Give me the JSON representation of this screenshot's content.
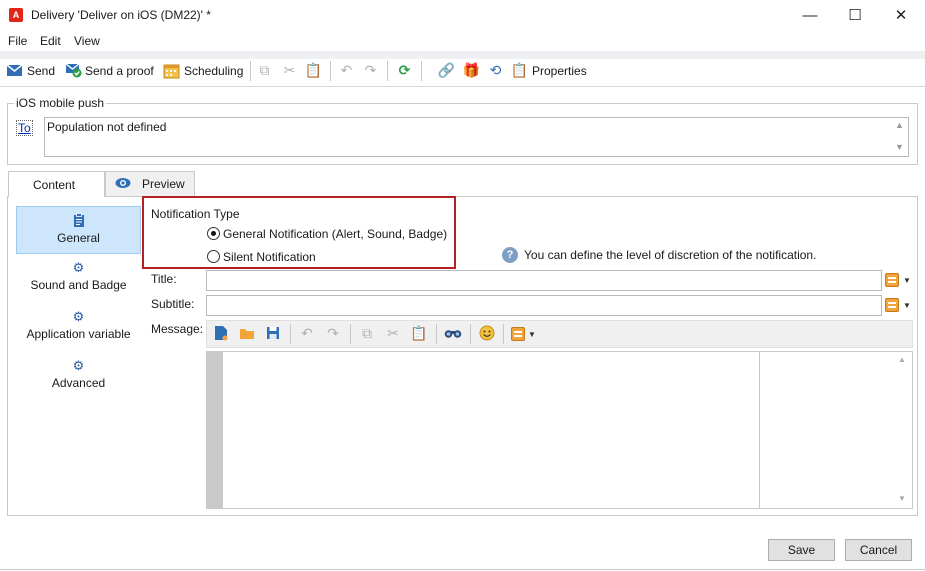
{
  "window": {
    "app_icon": "A",
    "title": "Delivery 'Deliver on iOS (DM22)' *",
    "controls": {
      "minimize": "—",
      "maximize": "☐",
      "close": "✕"
    }
  },
  "menu": [
    "File",
    "Edit",
    "View"
  ],
  "toolbar": {
    "send": "Send",
    "send_proof": "Send a proof",
    "scheduling": "Scheduling",
    "properties": "Properties",
    "icons": [
      "send-icon",
      "send-proof-icon",
      "calendar-icon",
      "copy-icon",
      "cut-icon",
      "paste-icon",
      "undo-icon",
      "redo-icon",
      "refresh-icon",
      "link-icon",
      "gift-icon",
      "gauge-icon",
      "clipboard-icon"
    ]
  },
  "push_group": {
    "legend": "iOS mobile push",
    "to_label": "To",
    "population": "Population not defined"
  },
  "tabs": [
    {
      "label": "Content",
      "icon": "apple-icon",
      "active": true
    },
    {
      "label": "Preview",
      "icon": "eye-icon",
      "active": false
    }
  ],
  "nav": [
    {
      "label": "General",
      "icon": "clipboard-icon",
      "selected": true
    },
    {
      "label": "Sound and Badge",
      "icon": "gears-icon"
    },
    {
      "label": "Application variable",
      "icon": "gears-icon"
    },
    {
      "label": "Advanced",
      "icon": "gears-icon"
    }
  ],
  "notification_type": {
    "label": "Notification Type",
    "options": [
      {
        "label": "General Notification (Alert, Sound, Badge)",
        "checked": true
      },
      {
        "label": "Silent Notification",
        "checked": false
      }
    ],
    "help_text": "You can define the level of discretion of the notification."
  },
  "fields": {
    "title_label": "Title:",
    "title_value": "",
    "subtitle_label": "Subtitle:",
    "subtitle_value": "",
    "message_label": "Message:"
  },
  "editor_toolbar_icons": [
    "new-file-icon",
    "open-folder-icon",
    "save-icon",
    "undo-icon",
    "redo-icon",
    "copy-icon",
    "cut-icon",
    "paste-icon",
    "find-icon",
    "emoji-icon",
    "insert-field-icon"
  ],
  "buttons": {
    "save": "Save",
    "cancel": "Cancel"
  },
  "colors": {
    "highlight_border": "#b22222",
    "selected_nav": "#cde6fb",
    "app_red": "#e1251b"
  }
}
